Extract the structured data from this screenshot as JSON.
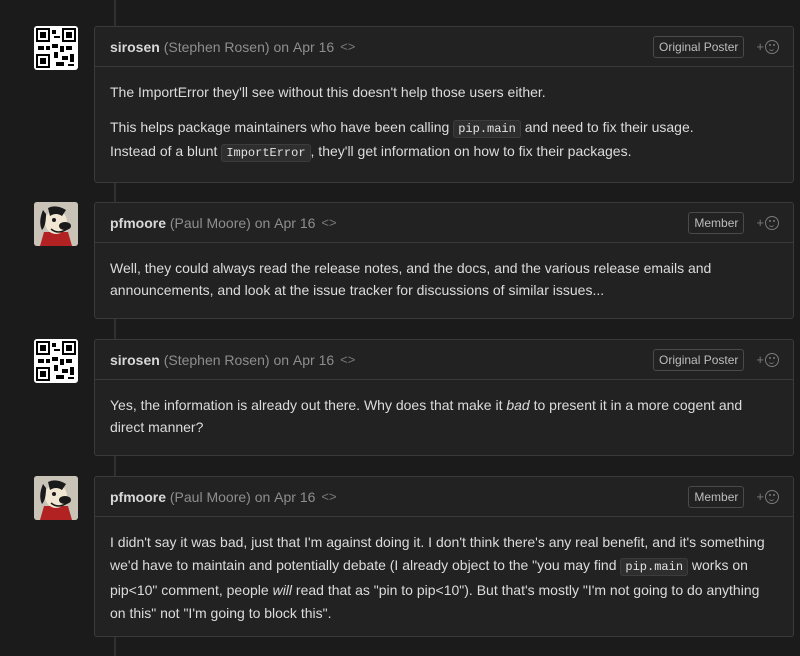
{
  "comments": [
    {
      "author": "sirosen",
      "fullname": "(Stephen Rosen)",
      "on": "on",
      "date": "Apr 16",
      "edit_icon": "<>",
      "badge": "Original Poster",
      "avatar": "qr-code-avatar",
      "react_plus": "+",
      "p1": "The ImportError they'll see without this doesn't help those users either.",
      "p2_a": "This helps package maintainers who have been calling ",
      "p2_code1": "pip.main",
      "p2_b": " and need to fix their usage.",
      "p2_c": "Instead of a blunt ",
      "p2_code2": "ImportError",
      "p2_d": ", they'll get information on how to fix their packages."
    },
    {
      "author": "pfmoore",
      "fullname": "(Paul Moore)",
      "on": "on",
      "date": "Apr 16",
      "edit_icon": "<>",
      "badge": "Member",
      "avatar": "cartoon-dog-avatar",
      "react_plus": "+",
      "p1": "Well, they could always read the release notes, and the docs, and the various release emails and announcements, and look at the issue tracker for discussions of similar issues..."
    },
    {
      "author": "sirosen",
      "fullname": "(Stephen Rosen)",
      "on": "on",
      "date": "Apr 16",
      "edit_icon": "<>",
      "badge": "Original Poster",
      "avatar": "qr-code-avatar",
      "react_plus": "+",
      "p1_a": "Yes, the information is already out there. Why does that make it ",
      "p1_em": "bad",
      "p1_b": " to present it in a more cogent and direct manner?"
    },
    {
      "author": "pfmoore",
      "fullname": "(Paul Moore)",
      "on": "on",
      "date": "Apr 16",
      "edit_icon": "<>",
      "badge": "Member",
      "avatar": "cartoon-dog-avatar",
      "react_plus": "+",
      "p1_a": "I didn't say it was bad, just that I'm against doing it. I don't think there's any real benefit, and it's something we'd have to maintain and potentially debate (I already object to the \"you may find ",
      "p1_code": "pip.main",
      "p1_b": " works on pip<10\" comment, people ",
      "p1_em": "will",
      "p1_c": " read that as \"pin to pip<10\"). But that's mostly \"I'm not going to do anything on this\" not \"I'm going to block this\"."
    }
  ]
}
